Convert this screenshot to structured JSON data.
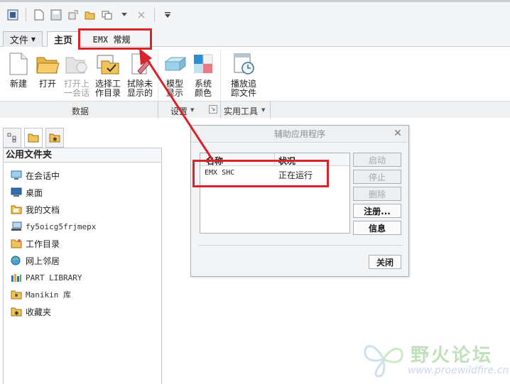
{
  "ribbon": {
    "tabs": {
      "file": "文件",
      "home": "主页",
      "emx": "EMX 常规"
    },
    "buttons": [
      {
        "label": "新建",
        "icon": "new-file-icon",
        "enabled": true
      },
      {
        "label": "打开",
        "icon": "open-folder-icon",
        "enabled": true
      },
      {
        "label": "打开上\n一会话",
        "icon": "open-last-session-icon",
        "enabled": false
      },
      {
        "label": "选择工\n作目录",
        "icon": "select-working-directory-icon",
        "enabled": true
      },
      {
        "label": "拭除未\n显示的",
        "icon": "erase-not-displayed-icon",
        "enabled": true
      },
      {
        "label": "模型\n显示",
        "icon": "model-display-icon",
        "enabled": true
      },
      {
        "label": "系统\n颜色",
        "icon": "system-colors-icon",
        "enabled": true
      },
      {
        "label": "播放追\n踪文件",
        "icon": "play-trail-file-icon",
        "enabled": true
      }
    ],
    "groups": {
      "data": "数据",
      "settings": "设置",
      "utilities": "实用工具"
    }
  },
  "panel": {
    "title": "公用文件夹",
    "items": [
      {
        "label": "在会话中",
        "icon": "in-session-icon"
      },
      {
        "label": "桌面",
        "icon": "desktop-icon"
      },
      {
        "label": "我的文档",
        "icon": "my-documents-icon"
      },
      {
        "label": "fy5oicg5frjmepx",
        "icon": "computer-icon"
      },
      {
        "label": "工作目录",
        "icon": "working-directory-icon"
      },
      {
        "label": "网上邻居",
        "icon": "network-icon"
      },
      {
        "label": "PART LIBRARY",
        "icon": "part-library-icon"
      },
      {
        "label": "Manikin 库",
        "icon": "manikin-library-icon"
      },
      {
        "label": "收藏夹",
        "icon": "favorites-icon"
      }
    ]
  },
  "dialog": {
    "title": "辅助应用程序",
    "columns": {
      "name": "名称",
      "status": "状况"
    },
    "rows": [
      {
        "name": "EMX SHC",
        "status": "正在运行"
      }
    ],
    "buttons": {
      "start": "启动",
      "stop": "停止",
      "delete": "删除",
      "register": "注册...",
      "info": "信息",
      "close": "关闭"
    }
  },
  "watermark": {
    "text": "野火论坛",
    "url": "www.proewildfire.cn"
  },
  "colors": {
    "highlight": "#d9232a",
    "accent": "#2a6fb0"
  }
}
